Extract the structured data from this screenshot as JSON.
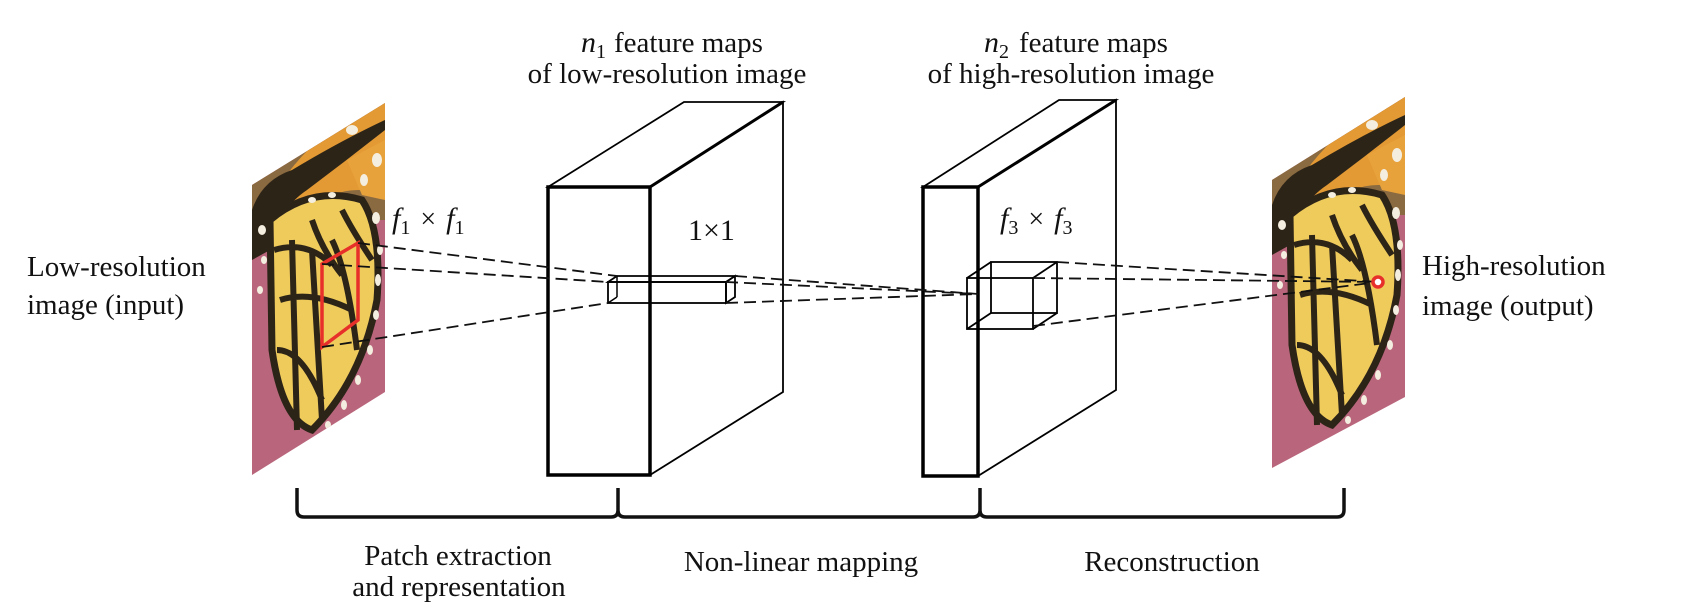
{
  "figure": {
    "input_label": [
      "Low-resolution",
      "image (input)"
    ],
    "output_label": [
      "High-resolution",
      "image (output)"
    ],
    "layer1_title": {
      "symbol": "n",
      "subscript": "1",
      "line1_rest": "feature maps",
      "line2": "of low-resolution image"
    },
    "layer2_title": {
      "symbol": "n",
      "subscript": "2",
      "line1_rest": "feature maps",
      "line2": "of high-resolution image"
    },
    "filter1_label": {
      "symbol": "f",
      "subscript": "1",
      "operator": "×"
    },
    "filter2_label": "1×1",
    "filter3_label": {
      "symbol": "f",
      "subscript": "3",
      "operator": "×"
    },
    "stages": [
      {
        "lines": [
          "Patch extraction",
          "and representation"
        ]
      },
      {
        "lines": [
          "Non-linear mapping"
        ]
      },
      {
        "lines": [
          "Reconstruction"
        ]
      }
    ],
    "colors": {
      "patch_highlight": "#e8302a",
      "output_pixel": "#e8302a",
      "wing_orange": "#e39a34",
      "wing_yellow": "#efcb5c",
      "wing_vein": "#2d2418",
      "background_pink": "#c25a7c"
    }
  }
}
